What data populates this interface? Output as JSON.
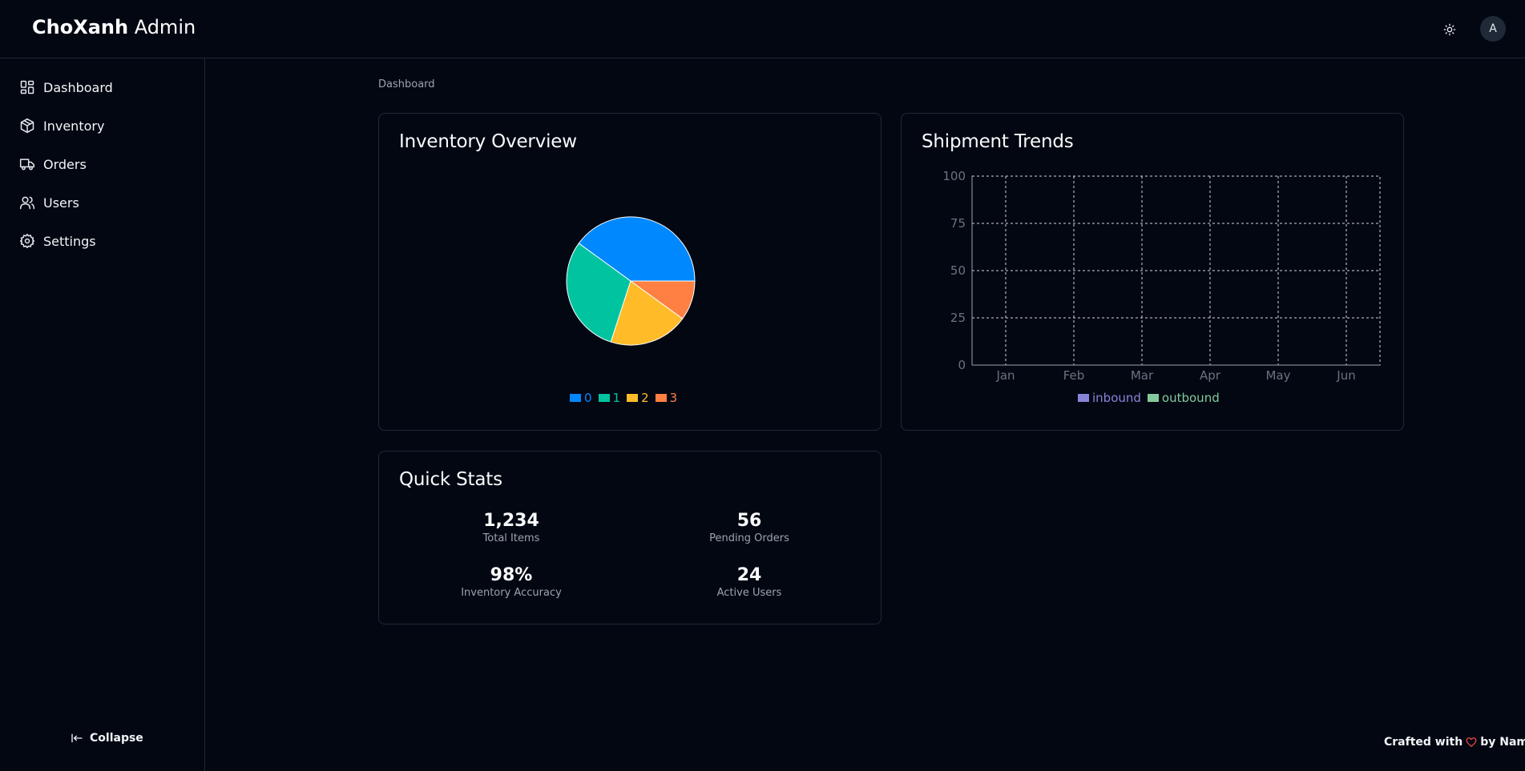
{
  "app": {
    "brand_bold": "ChoXanh",
    "brand_light": "Admin",
    "avatar_initial": "A"
  },
  "sidebar": {
    "items": [
      {
        "label": "Dashboard",
        "icon": "dashboard-icon"
      },
      {
        "label": "Inventory",
        "icon": "box-icon"
      },
      {
        "label": "Orders",
        "icon": "truck-icon"
      },
      {
        "label": "Users",
        "icon": "users-icon"
      },
      {
        "label": "Settings",
        "icon": "gear-icon"
      }
    ],
    "collapse_label": "Collapse"
  },
  "breadcrumb": "Dashboard",
  "inventory_card": {
    "title": "Inventory Overview"
  },
  "shipment_card": {
    "title": "Shipment Trends"
  },
  "quick_stats": {
    "title": "Quick Stats",
    "stats": [
      {
        "value": "1,234",
        "label": "Total Items"
      },
      {
        "value": "56",
        "label": "Pending Orders"
      },
      {
        "value": "98%",
        "label": "Inventory Accuracy"
      },
      {
        "value": "24",
        "label": "Active Users"
      }
    ]
  },
  "footer": {
    "prefix": "Crafted with",
    "suffix": "by Nam Vu"
  },
  "colors": {
    "accent_blue": "#0088fe",
    "teal": "#00c49f",
    "yellow": "#ffbb28",
    "orange": "#ff8042",
    "inbound": "#8884d8",
    "outbound": "#82ca9d"
  },
  "chart_data": [
    {
      "type": "pie",
      "title": "",
      "categories": [
        "0",
        "1",
        "2",
        "3"
      ],
      "values": [
        40,
        30,
        20,
        10
      ],
      "colors": [
        "#0088fe",
        "#00c49f",
        "#ffbb28",
        "#ff8042"
      ],
      "legend": "bottom"
    },
    {
      "type": "line",
      "title": "",
      "categories": [
        "Jan",
        "Feb",
        "Mar",
        "Apr",
        "May",
        "Jun"
      ],
      "series": [
        {
          "name": "inbound",
          "values": [],
          "color": "#8884d8"
        },
        {
          "name": "outbound",
          "values": [],
          "color": "#82ca9d"
        }
      ],
      "yticks": [
        0,
        25,
        50,
        75,
        100
      ],
      "ylim": [
        0,
        100
      ],
      "grid": true,
      "legend": "bottom"
    }
  ]
}
